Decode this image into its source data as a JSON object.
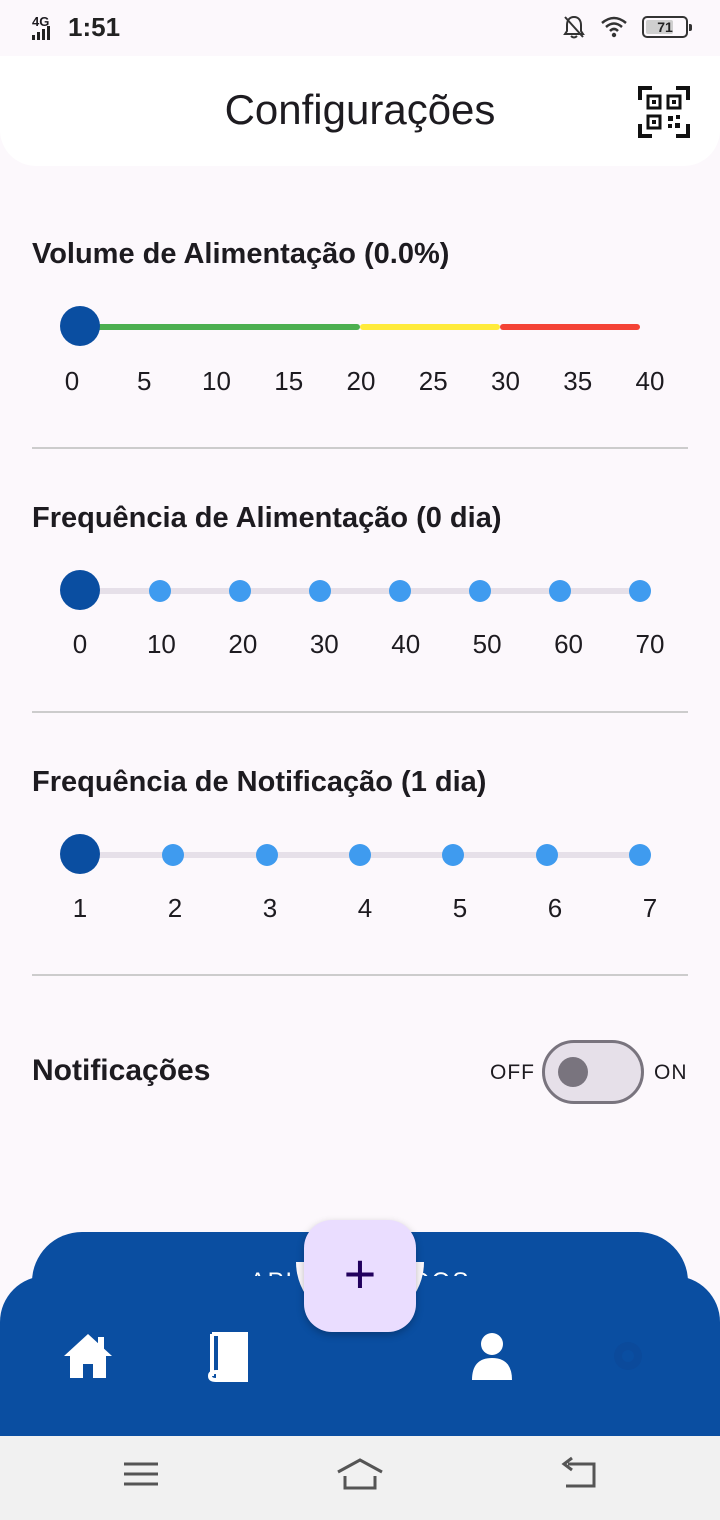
{
  "status_bar": {
    "network": "4G",
    "time": "1:51",
    "battery": "71",
    "battery_level": 0.71
  },
  "header": {
    "title": "Configurações",
    "qr_icon": "qr-code-icon"
  },
  "volume": {
    "title": "Volume de Alimentação (0.0%)",
    "value": 0,
    "min": 0,
    "max": 40,
    "ticks": [
      "0",
      "5",
      "10",
      "15",
      "20",
      "25",
      "30",
      "35",
      "40"
    ],
    "zones": [
      {
        "from": 0,
        "to": 20,
        "color": "#4caf50"
      },
      {
        "from": 20,
        "to": 30,
        "color": "#ffeb3b"
      },
      {
        "from": 30,
        "to": 40,
        "color": "#f44336"
      }
    ]
  },
  "feed_frequency": {
    "title": "Frequência de Alimentação (0 dia)",
    "value": 0,
    "ticks": [
      "0",
      "10",
      "20",
      "30",
      "40",
      "50",
      "60",
      "70"
    ]
  },
  "notification_frequency": {
    "title": "Frequência de Notificação (1 dia)",
    "value": 1,
    "ticks": [
      "1",
      "2",
      "3",
      "4",
      "5",
      "6",
      "7"
    ]
  },
  "notifications": {
    "label": "Notificações",
    "off_label": "OFF",
    "on_label": "ON",
    "enabled": false
  },
  "apply_button": {
    "label": "APLICAR DADOS"
  },
  "fab": {
    "label": "+"
  },
  "bottom_nav": {
    "items": [
      "home-icon",
      "book-icon",
      "user-icon",
      "settings-icon"
    ]
  },
  "colors": {
    "primary": "#0a4ea1",
    "accent_dot": "#3f9bef",
    "fab_bg": "#eaddff",
    "track": "#e6e0e9"
  }
}
